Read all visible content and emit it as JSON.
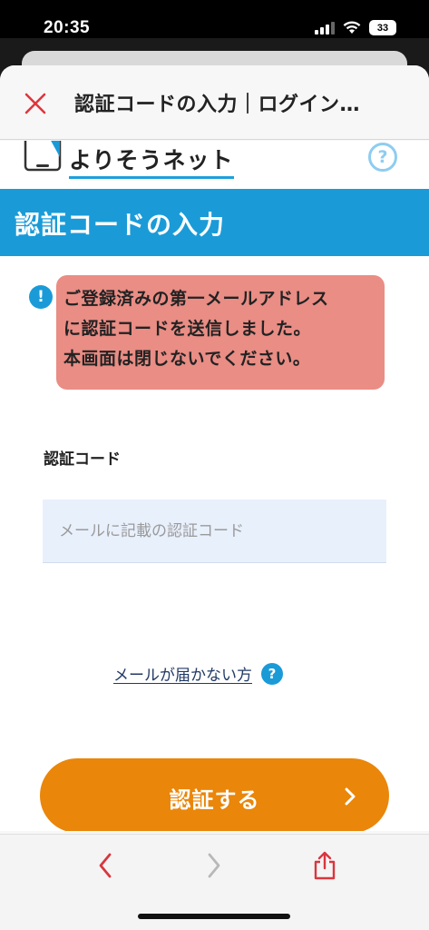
{
  "status_bar": {
    "time": "20:35",
    "battery": "33"
  },
  "modal": {
    "title": "認証コードの入力｜ログイン…"
  },
  "brand": {
    "name": "よりそうネット",
    "help_symbol": "?"
  },
  "banner": {
    "title": "認証コードの入力"
  },
  "notice": {
    "icon_symbol": "!",
    "lines": [
      "ご登録済みの第一メールアドレス",
      "に認証コードを送信しました。",
      "本画面は閉じないでください。"
    ]
  },
  "form": {
    "code_label": "認証コード",
    "code_placeholder": "メールに記載の認証コード",
    "code_value": ""
  },
  "links": {
    "mail_not_arrived": "メールが届かない方",
    "help_symbol": "?"
  },
  "submit": {
    "label": "認証する"
  },
  "colors": {
    "brand_blue": "#1a9bd8",
    "button_orange": "#ea860a",
    "highlight_red": "#e8877e",
    "toolbar_red": "#d9363e"
  },
  "icons": {
    "close": "close-icon",
    "back": "chevron-left-icon",
    "forward": "chevron-right-icon",
    "share": "share-icon"
  }
}
